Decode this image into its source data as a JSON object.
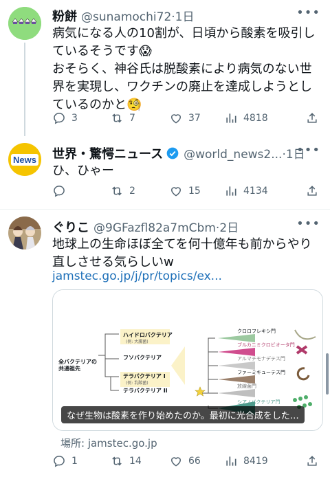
{
  "tweets": [
    {
      "name": "粉餅",
      "handle": "@sunamochi72",
      "time": "1日",
      "body": "病気になる人の10割が、日頃から酸素を吸引しているそうです😱\nおそらく、神谷氏は脱酸素により病気のない世界を実現し、ワクチンの廃止を達成しようとしているのかと🧐",
      "replies": "3",
      "retweets": "7",
      "likes": "37",
      "views": "4818"
    },
    {
      "name": "世界・驚愕ニュース",
      "handle": "@world_news2...",
      "time": "1日",
      "avatar_text": "News",
      "body": "ひ、ひゃー",
      "replies": "",
      "retweets": "2",
      "likes": "15",
      "views": "4134"
    },
    {
      "name": "ぐりこ",
      "handle": "@9GFazfl82a7mCbm",
      "time": "2日",
      "body": "地球上の生命ほぼ全てを何十億年も前からやり直しさせる気らしいw",
      "link": "jamstec.go.jp/j/pr/topics/ex...",
      "card": {
        "root_label": "全バクテリアの\n共通祖先",
        "left_labels": [
          "ハイドロバクテリア",
          "(例: 大腸菌)",
          "フソバクテリア",
          "テラバクテリア I",
          "(例: 乳酸菌)",
          "テラバクテリア II"
        ],
        "right_labels": [
          "クロロフレキシ門",
          "ブルカニミクロビオータ門",
          "アルマチモナデテス門",
          "ファーミキューテス門",
          "放線菌門",
          "シアノバクテリア門"
        ],
        "caption": "なぜ生物は酸素を作り始めたのか。最初に光合成をした…"
      },
      "source": "場所: jamstec.go.jp",
      "replies": "1",
      "retweets": "14",
      "likes": "66",
      "views": "8419"
    }
  ],
  "colors": {
    "link": "#1d6fb8",
    "muted": "#536471",
    "verified": "#1d9bf0",
    "news_avatar_bg": "#f5c400"
  },
  "icons": [
    "reply-icon",
    "retweet-icon",
    "like-icon",
    "views-icon",
    "share-icon",
    "more-icon",
    "verified-icon"
  ]
}
